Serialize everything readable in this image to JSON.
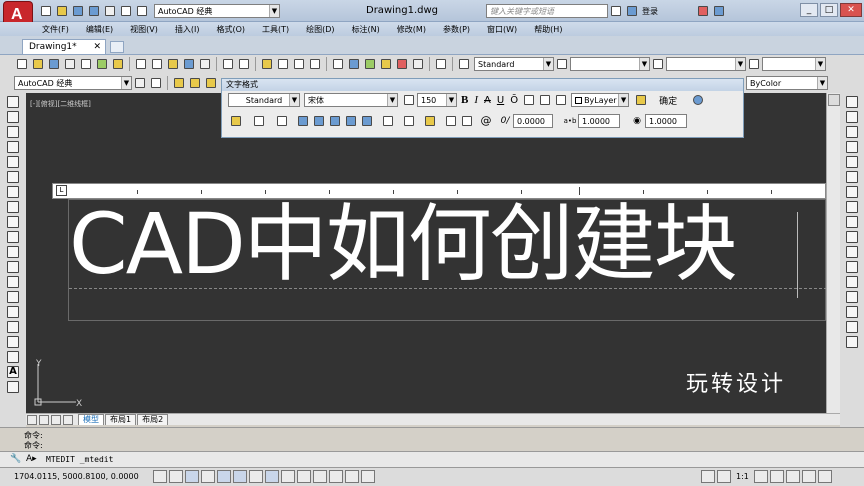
{
  "window": {
    "title": "Drawing1.dwg",
    "search_placeholder": "键入关键字或短语",
    "login": "登录",
    "workspace": "AutoCAD 经典"
  },
  "menu": [
    "文件(F)",
    "编辑(E)",
    "视图(V)",
    "插入(I)",
    "格式(O)",
    "工具(T)",
    "绘图(D)",
    "标注(N)",
    "修改(M)",
    "参数(P)",
    "窗口(W)",
    "帮助(H)"
  ],
  "doc_tab": "Drawing1*",
  "toolbar": {
    "text_style": "Standard",
    "workspace_combo": "AutoCAD 经典",
    "bylayer_right": "ByColor"
  },
  "text_format": {
    "title": "文字格式",
    "style": "Standard",
    "font": "宋体",
    "height": "150",
    "bold": "B",
    "italic": "I",
    "strike": "A",
    "underline": "U",
    "overline": "Ō",
    "color": "ByLayer",
    "ok": "确定",
    "oblique": "0.0000",
    "tracking": "1.0000",
    "width_factor": "1.0000"
  },
  "viewport_label": "[-][俯视][二维线框]",
  "mtext": {
    "content": "CAD中如何创建块"
  },
  "watermark": "玩转设计",
  "layout_tabs": [
    "模型",
    "布局1",
    "布局2"
  ],
  "command": {
    "line1": "命令:",
    "line2": "命令:",
    "input": "MTEDIT _mtedit"
  },
  "status": {
    "coords": "1704.0115, 5000.8100, 0.0000",
    "scale": "1:1"
  }
}
